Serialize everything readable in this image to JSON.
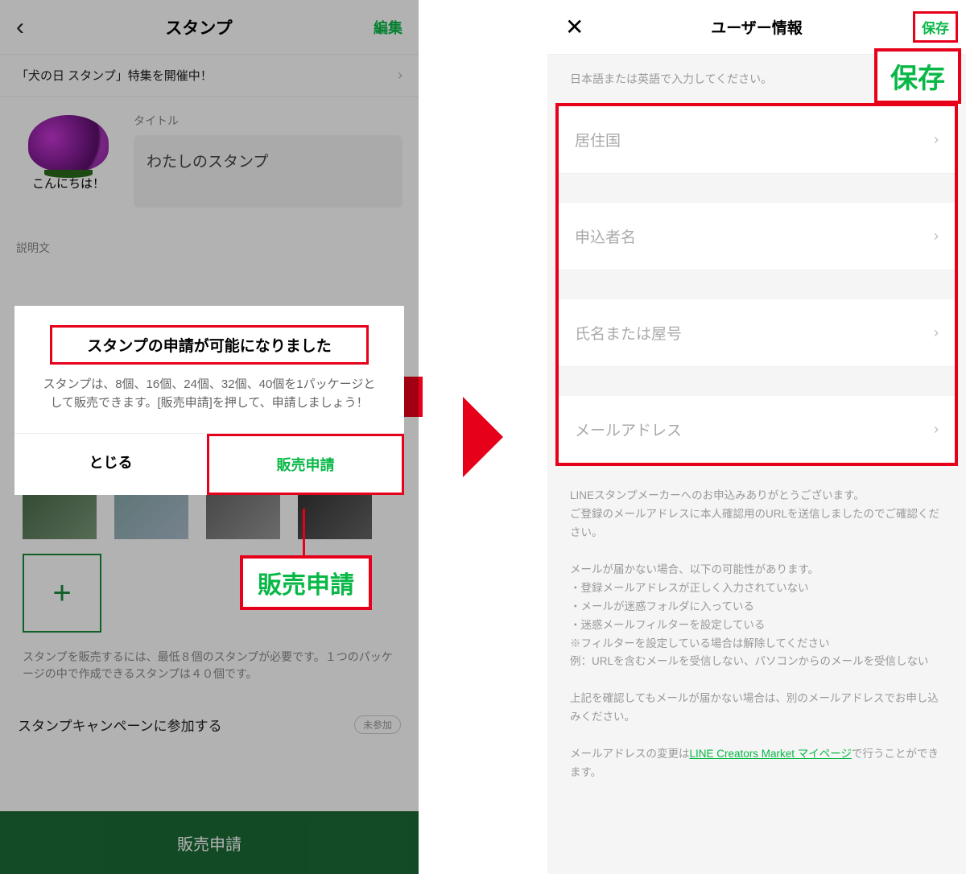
{
  "left": {
    "header": {
      "title": "スタンプ",
      "edit": "編集"
    },
    "banner": "「犬の日 スタンプ」特集を開催中！",
    "stamp_hello": "こんにちは！",
    "title_label": "タイトル",
    "title_value": "わたしのスタンプ",
    "desc_label": "説明文",
    "hint": "スタンプを販売するには、最低８個のスタンプが必要です。１つのパッケージの中で作成できるスタンプは４０個です。",
    "campaign": "スタンプキャンペーンに参加する",
    "campaign_badge": "未参加",
    "bottom_button": "販売申請",
    "modal": {
      "title": "スタンプの申請が可能になりました",
      "body": "スタンプは、8個、16個、24個、32個、40個を1パッケージとして販売できます。[販売申請]を押して、申請しましょう！",
      "close": "とじる",
      "apply": "販売申請"
    },
    "callout_apply": "販売申請"
  },
  "right": {
    "header": {
      "title": "ユーザー情報",
      "save": "保存"
    },
    "callout_save": "保存",
    "hint": "日本語または英語で入力してください。",
    "fields": {
      "country": "居住国",
      "applicant": "申込者名",
      "name": "氏名または屋号",
      "email": "メールアドレス"
    },
    "info1": "LINEスタンプメーカーへのお申込みありがとうございます。\nご登録のメールアドレスに本人確認用のURLを送信しましたのでご確認ください。",
    "info2": "メールが届かない場合、以下の可能性があります。\n・登録メールアドレスが正しく入力されていない\n・メールが迷惑フォルダに入っている\n・迷惑メールフィルターを設定している\n※フィルターを設定している場合は解除してください\n例：URLを含むメールを受信しない、パソコンからのメールを受信しない",
    "info3": "上記を確認してもメールが届かない場合は、別のメールアドレスでお申し込みください。",
    "info4_pre": "メールアドレスの変更は",
    "info4_link": "LINE Creators Market マイページ",
    "info4_post": "で行うことができます。"
  }
}
